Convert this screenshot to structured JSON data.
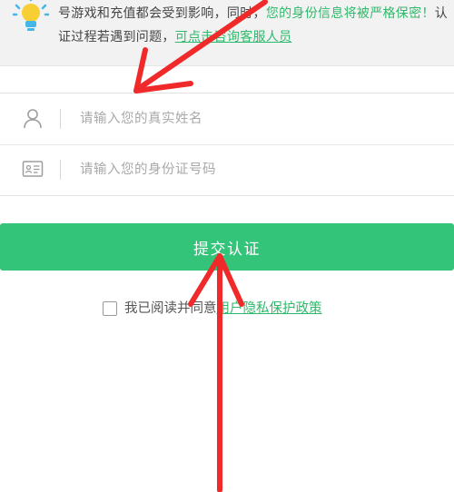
{
  "notice": {
    "text_prefix": "号游戏和充值都会受到影响，同时，",
    "text_green": "您的身份信息将被严格保密！",
    "text_mid": "认证过程若遇到问题，",
    "link": "可点击咨询客服人员"
  },
  "form": {
    "name_placeholder": "请输入您的真实姓名",
    "id_placeholder": "请输入您的身份证号码"
  },
  "submit": {
    "label": "提交认证"
  },
  "agreement": {
    "text": "我已阅读并同意",
    "policy": "用户隐私保护政策"
  },
  "colors": {
    "accent": "#33c47a",
    "link": "#2fb96a",
    "annotation": "#f02a2a"
  }
}
